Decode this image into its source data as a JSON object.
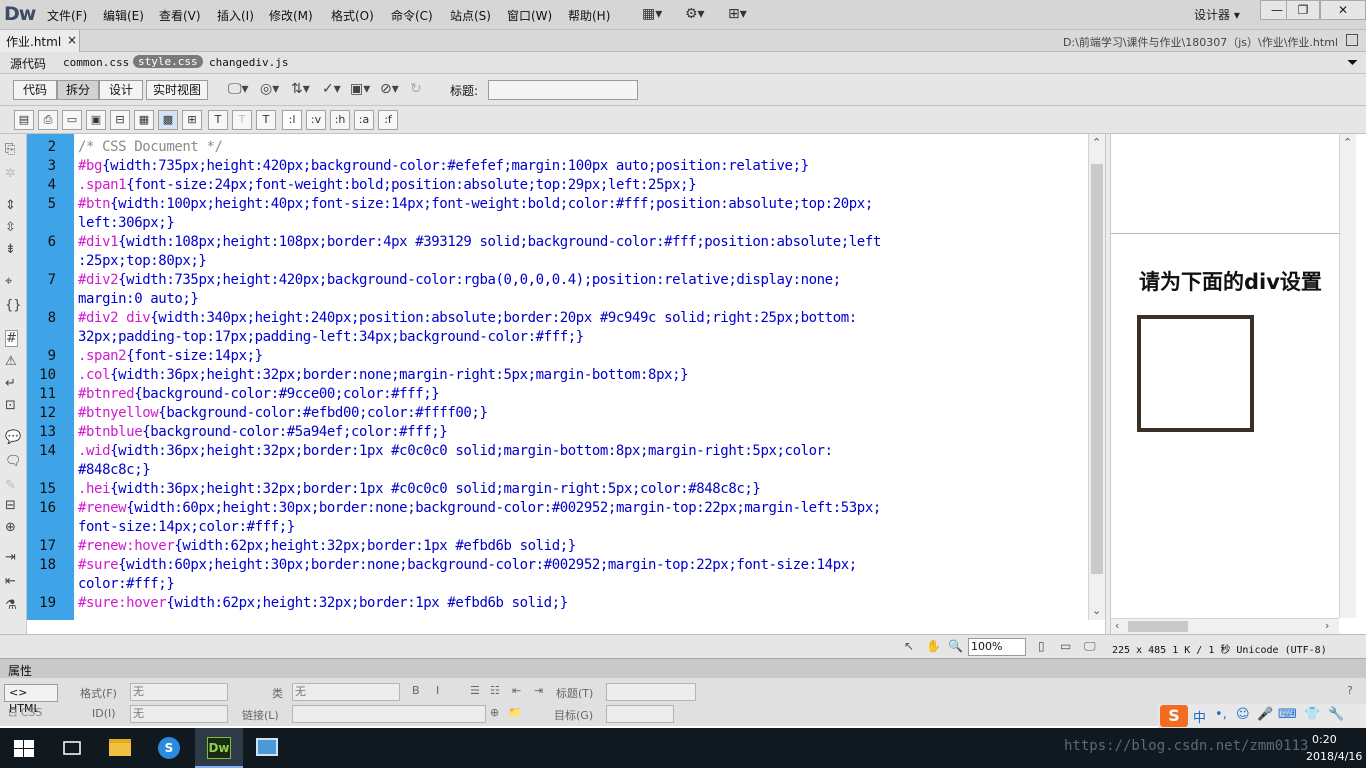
{
  "app": {
    "logo": "Dw",
    "workspace": "设计器 ▾"
  },
  "menu": [
    "文件(F)",
    "编辑(E)",
    "查看(V)",
    "插入(I)",
    "修改(M)",
    "格式(O)",
    "命令(C)",
    "站点(S)",
    "窗口(W)",
    "帮助(H)"
  ],
  "window_buttons": {
    "min": "—",
    "restore": "❐",
    "close": "✕"
  },
  "doc_tab": {
    "label": "作业.html",
    "close": "×"
  },
  "doc_path": "D:\\前端学习\\课件与作业\\180307（js）\\作业\\作业.html",
  "related_files": {
    "source": "源代码",
    "files": [
      "common.css",
      "style.css",
      "changediv.js"
    ],
    "selected": "style.css"
  },
  "view_buttons": {
    "code": "代码",
    "split": "拆分",
    "design": "设计",
    "live": "实时视图"
  },
  "title_label": "标题:",
  "title_value": "",
  "code_toolbar": [
    "T",
    "T",
    "T",
    ":l",
    ":v",
    ":h",
    ":a",
    ":f"
  ],
  "line_numbers": [
    "2",
    "3",
    "4",
    "5",
    "",
    "6",
    "",
    "7",
    "",
    "8",
    "",
    "9",
    "10",
    "11",
    "12",
    "13",
    "14",
    "",
    "15",
    "16",
    "",
    "17",
    "18",
    "",
    "19"
  ],
  "code_lines": [
    {
      "sel": "",
      "body": "/* CSS Document */",
      "comment": true
    },
    {
      "sel": "#bg",
      "body": "{width:735px;height:420px;background-color:#efefef;margin:100px auto;position:relative;}"
    },
    {
      "sel": ".span1",
      "body": "{font-size:24px;font-weight:bold;position:absolute;top:29px;left:25px;}"
    },
    {
      "sel": "#btn",
      "body": "{width:100px;height:40px;font-size:14px;font-weight:bold;color:#fff;position:absolute;top:20px;"
    },
    {
      "sel": "",
      "body": "left:306px;}"
    },
    {
      "sel": "#div1",
      "body": "{width:108px;height:108px;border:4px #393129 solid;background-color:#fff;position:absolute;left"
    },
    {
      "sel": "",
      "body": ":25px;top:80px;}"
    },
    {
      "sel": "#div2",
      "body": "{width:735px;height:420px;background-color:rgba(0,0,0,0.4);position:relative;display:none;"
    },
    {
      "sel": "",
      "body": "margin:0 auto;}"
    },
    {
      "sel": "#div2 div",
      "body": "{width:340px;height:240px;position:absolute;border:20px #9c949c solid;right:25px;bottom:"
    },
    {
      "sel": "",
      "body": "32px;padding-top:17px;padding-left:34px;background-color:#fff;}"
    },
    {
      "sel": ".span2",
      "body": "{font-size:14px;}"
    },
    {
      "sel": ".col",
      "body": "{width:36px;height:32px;border:none;margin-right:5px;margin-bottom:8px;}"
    },
    {
      "sel": "#btnred",
      "body": "{background-color:#9cce00;color:#fff;}"
    },
    {
      "sel": "#btnyellow",
      "body": "{background-color:#efbd00;color:#ffff00;}"
    },
    {
      "sel": "#btnblue",
      "body": "{background-color:#5a94ef;color:#fff;}"
    },
    {
      "sel": ".wid",
      "body": "{width:36px;height:32px;border:1px #c0c0c0 solid;margin-bottom:8px;margin-right:5px;color:"
    },
    {
      "sel": "",
      "body": "#848c8c;}"
    },
    {
      "sel": ".hei",
      "body": "{width:36px;height:32px;border:1px #c0c0c0 solid;margin-right:5px;color:#848c8c;}"
    },
    {
      "sel": "#renew",
      "body": "{width:60px;height:30px;border:none;background-color:#002952;margin-top:22px;margin-left:53px;"
    },
    {
      "sel": "",
      "body": "font-size:14px;color:#fff;}"
    },
    {
      "sel": "#renew:hover",
      "body": "{width:62px;height:32px;border:1px #efbd6b solid;}"
    },
    {
      "sel": "#sure",
      "body": "{width:60px;height:30px;border:none;background-color:#002952;margin-top:22px;font-size:14px;"
    },
    {
      "sel": "",
      "body": "color:#fff;}"
    },
    {
      "sel": "#sure:hover",
      "body": "{width:62px;height:32px;border:1px #efbd6b solid;}"
    }
  ],
  "design_view": {
    "heading": "请为下面的div设置"
  },
  "status": {
    "zoom": "100%",
    "size": "225 x 485",
    "info": "1 K / 1 秒 Unicode (UTF-8)"
  },
  "properties": {
    "title": "属性",
    "html_btn": "HTML",
    "css_btn": "CSS",
    "format_label": "格式(F)",
    "format_value": "无",
    "class_label": "类",
    "class_value": "无",
    "id_label": "ID(I)",
    "id_value": "无",
    "link_label": "链接(L)",
    "title_label": "标题(T)",
    "target_label": "目标(G)"
  },
  "ime": {
    "logo": "S",
    "items": [
      "中",
      "•,",
      "☺",
      "🎤",
      "⌨",
      "👕",
      "🔧"
    ]
  },
  "taskbar": {
    "time": "0:20",
    "date": "2018/4/16"
  },
  "watermark": "https://blog.csdn.net/zmm0113"
}
